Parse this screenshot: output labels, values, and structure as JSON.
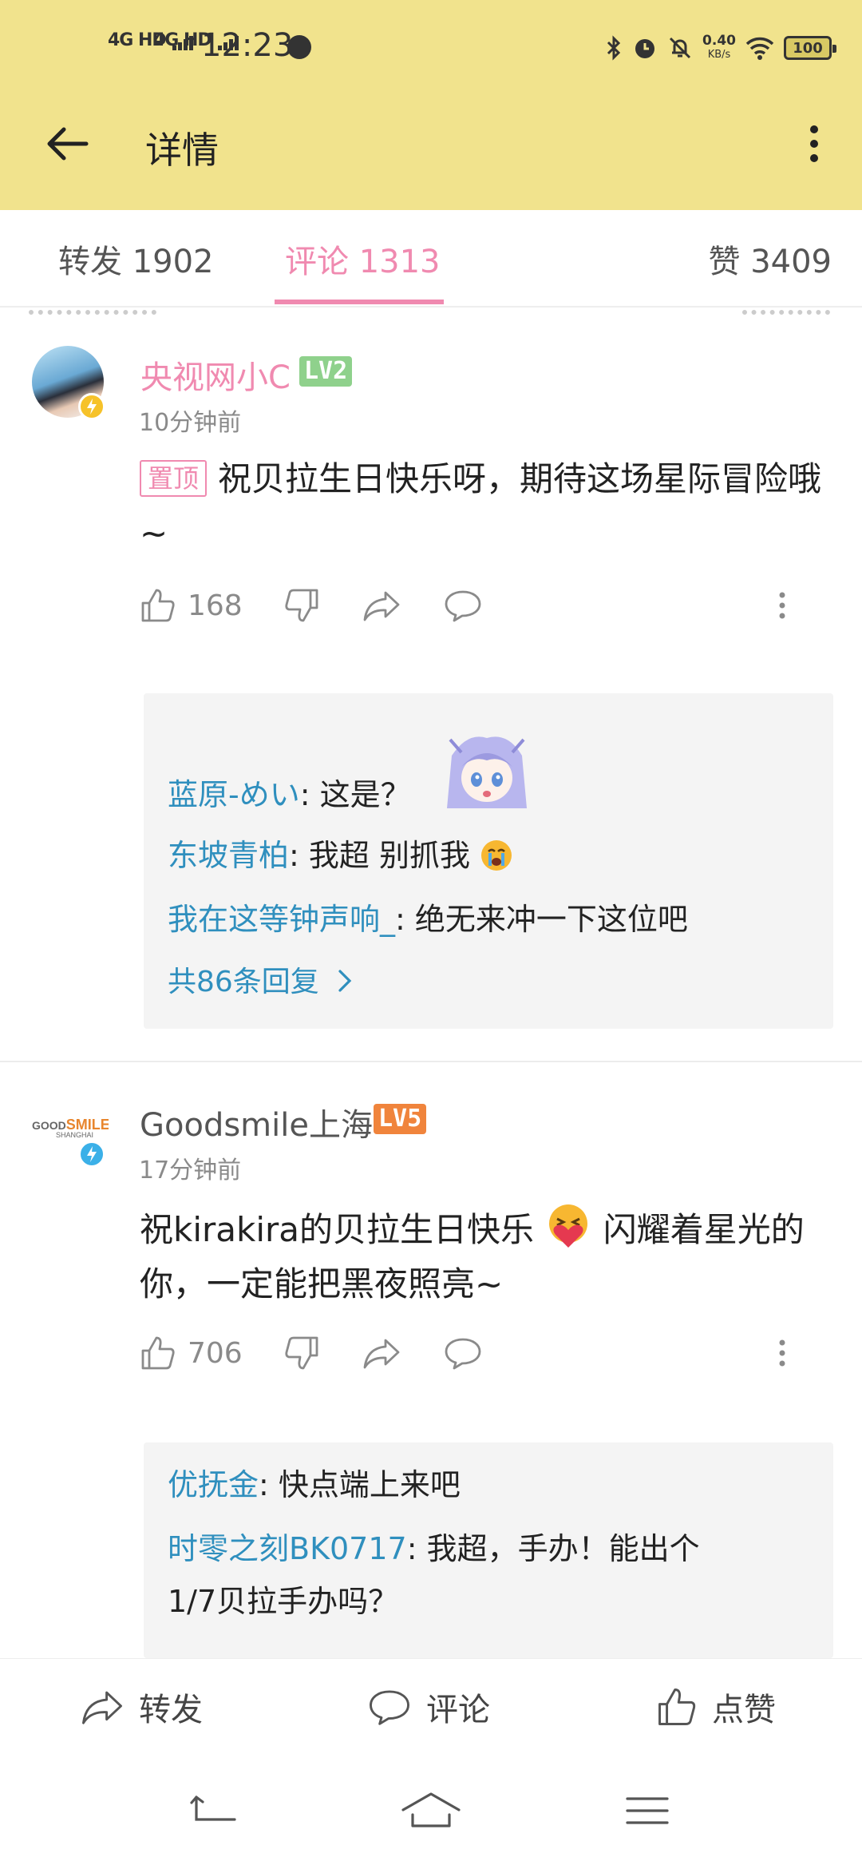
{
  "status_bar": {
    "signal_1": "4G HD",
    "signal_2": "4G HD",
    "time": "12:23",
    "net_speed_value": "0.40",
    "net_speed_unit": "KB/s",
    "battery": "100"
  },
  "app_bar": {
    "title": "详情"
  },
  "tabs": {
    "repost": "转发 1902",
    "comment": "评论 1313",
    "like": "赞 3409",
    "active": "comment"
  },
  "comments": [
    {
      "username": "央视网小C",
      "level": "LV2",
      "time": "10分钟前",
      "pinned_tag": "置顶",
      "text": "祝贝拉生日快乐呀，期待这场星际冒险哦~",
      "like_count": "168",
      "replies": [
        {
          "user": "蓝原-めい",
          "text": ": 这是？"
        },
        {
          "user": "东坡青柏",
          "text": ": 我超 别抓我"
        },
        {
          "user": "我在这等钟声响_",
          "text": ": 绝无来冲一下这位吧"
        }
      ],
      "more_replies": "共86条回复"
    },
    {
      "username": "Goodsmile上海",
      "level": "LV5",
      "time": "17分钟前",
      "text_part1": "祝kirakira的贝拉生日快乐",
      "text_part2": "闪耀着星光的你，一定能把黑夜照亮~",
      "like_count": "706",
      "avatar_logo_line1": "GOOD",
      "avatar_logo_line1b": "SMILE",
      "avatar_logo_line2": "SHANGHAI",
      "replies": [
        {
          "user": "优抚金",
          "text": ": 快点端上来吧"
        },
        {
          "user": "时零之刻BK0717",
          "text": ": 我超，手办！能出个"
        },
        {
          "user": "",
          "text": "1/7贝拉手办吗？"
        }
      ]
    }
  ],
  "bottom_bar": {
    "repost": "转发",
    "comment": "评论",
    "like": "点赞"
  },
  "colors": {
    "header_bg": "#F1E38D",
    "accent_pink": "#F08AB0",
    "link_blue": "#2F8FBE",
    "lv2_green": "#8FD18C",
    "lv5_orange": "#F0843C"
  }
}
